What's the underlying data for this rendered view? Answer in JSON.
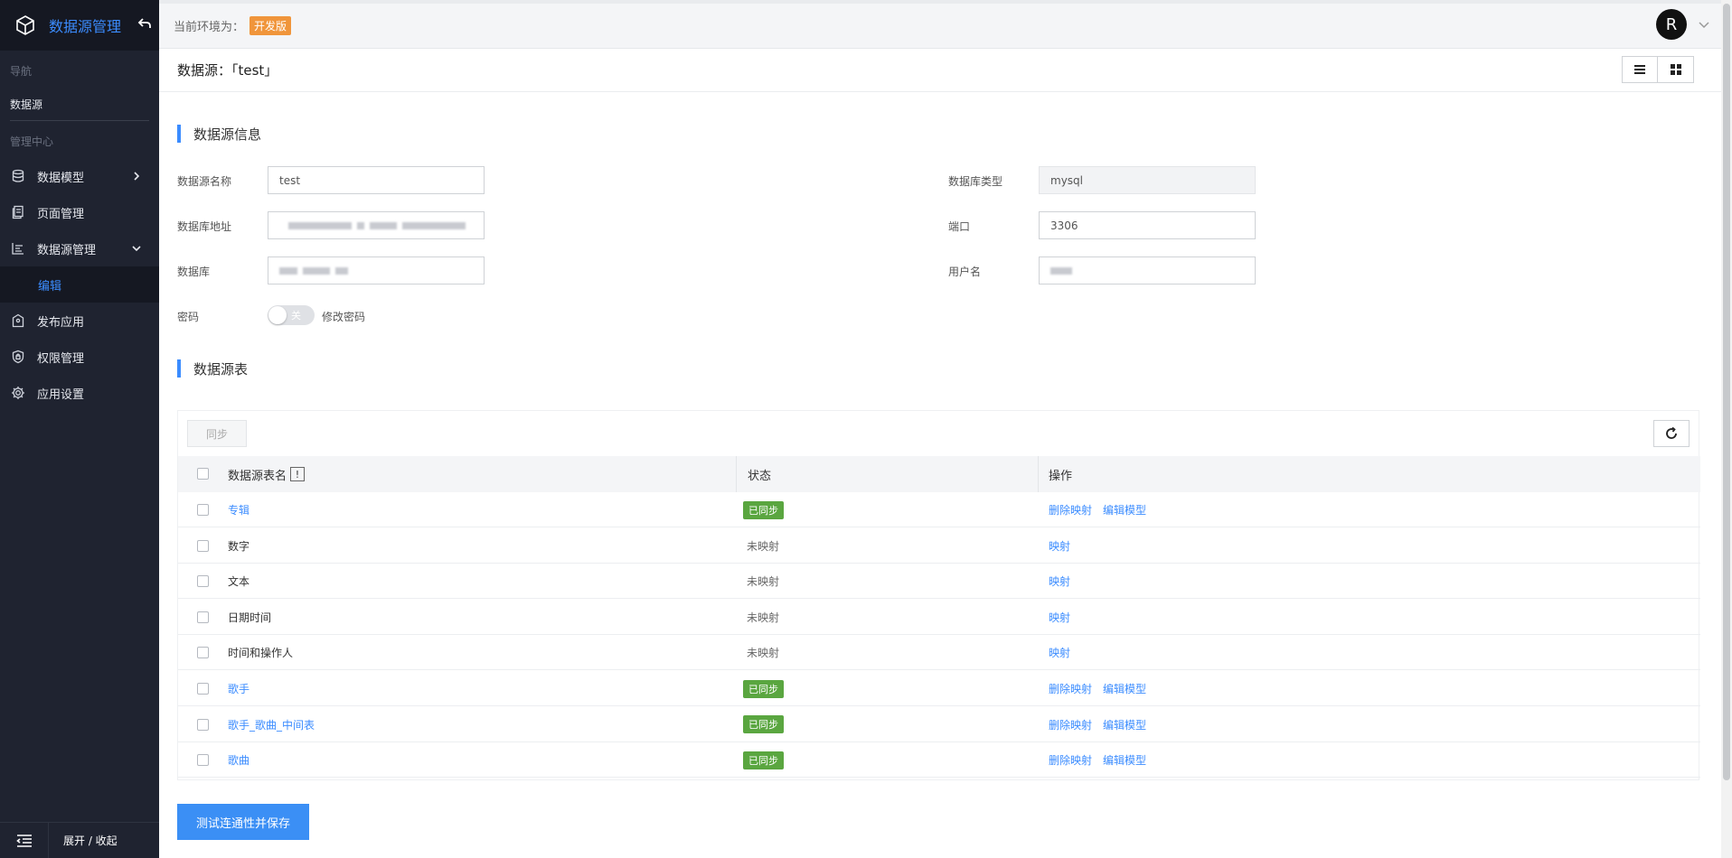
{
  "sidebar": {
    "title": "数据源管理",
    "section_nav": "导航",
    "nav_item": "数据源",
    "section_admin": "管理中心",
    "items": [
      {
        "label": "数据模型"
      },
      {
        "label": "页面管理"
      },
      {
        "label": "数据源管理"
      },
      {
        "label": "编辑"
      },
      {
        "label": "发布应用"
      },
      {
        "label": "权限管理"
      },
      {
        "label": "应用设置"
      }
    ],
    "footer_label": "展开 / 收起"
  },
  "topbar": {
    "env_label": "当前环境为：",
    "env_badge": "开发版",
    "avatar_letter": "R"
  },
  "page": {
    "title": "数据源：「test」"
  },
  "info_section": {
    "title": "数据源信息",
    "fields": {
      "name_label": "数据源名称",
      "name_value": "test",
      "type_label": "数据库类型",
      "type_value": "mysql",
      "addr_label": "数据库地址",
      "port_label": "端口",
      "port_value": "3306",
      "db_label": "数据库",
      "user_label": "用户名",
      "password_label": "密码",
      "switch_text": "关",
      "change_password": "修改密码"
    }
  },
  "table_section": {
    "title": "数据源表",
    "sync_button": "同步",
    "headers": {
      "name": "数据源表名",
      "info": "!",
      "status": "状态",
      "actions": "操作"
    },
    "rows": [
      {
        "name": "专辑",
        "synced": true,
        "status": "已同步",
        "actions": [
          "删除映射",
          "编辑模型"
        ]
      },
      {
        "name": "数字",
        "synced": false,
        "status": "未映射",
        "actions": [
          "映射"
        ]
      },
      {
        "name": "文本",
        "synced": false,
        "status": "未映射",
        "actions": [
          "映射"
        ]
      },
      {
        "name": "日期时间",
        "synced": false,
        "status": "未映射",
        "actions": [
          "映射"
        ]
      },
      {
        "name": "时间和操作人",
        "synced": false,
        "status": "未映射",
        "actions": [
          "映射"
        ]
      },
      {
        "name": "歌手",
        "synced": true,
        "status": "已同步",
        "actions": [
          "删除映射",
          "编辑模型"
        ]
      },
      {
        "name": "歌手_歌曲_中间表",
        "synced": true,
        "status": "已同步",
        "actions": [
          "删除映射",
          "编辑模型"
        ]
      },
      {
        "name": "歌曲",
        "synced": true,
        "status": "已同步",
        "actions": [
          "删除映射",
          "编辑模型"
        ]
      }
    ]
  },
  "save_button": "测试连通性并保存",
  "colors": {
    "accent": "#3b8cff",
    "sidebar_bg": "#1f2330",
    "synced_tag": "#5aa640",
    "env_badge": "#f0953b"
  }
}
